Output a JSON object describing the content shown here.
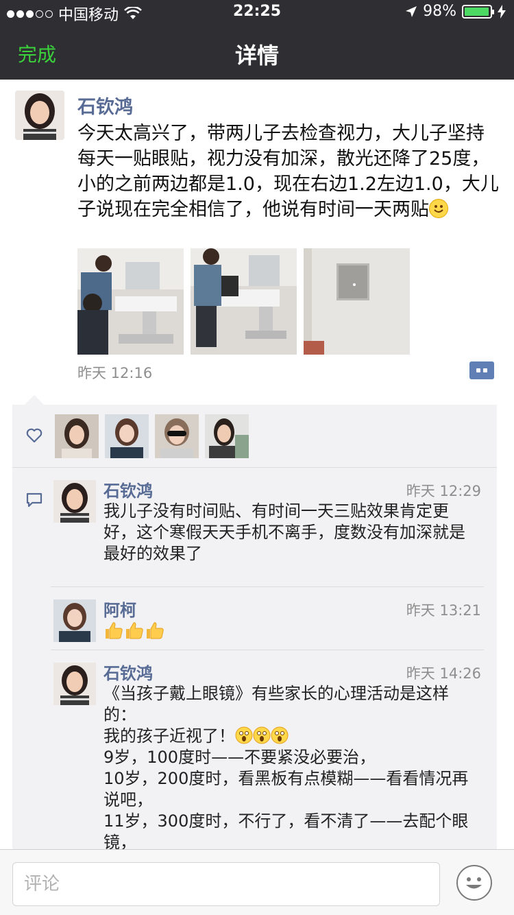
{
  "status_bar": {
    "carrier": "中国移动",
    "time": "22:25",
    "battery": "98%",
    "battery_level": 0.98
  },
  "nav": {
    "done_label": "完成",
    "title": "详情"
  },
  "post": {
    "author": "石钦鸿",
    "text": "今天太高兴了，带两儿子去检查视力，大儿子坚持每天一贴眼贴，视力没有加深，散光还降了25度，小的之前两边都是1.0，现在右边1.2左边1.0，大儿子说现在完全相信了，他说有时间一天两贴",
    "time": "昨天 12:16",
    "photo_count": 3
  },
  "likes": {
    "count": 4
  },
  "comments": [
    {
      "name": "石钦鸿",
      "time": "昨天 12:29",
      "text": "我儿子没有时间贴、有时间一天三贴效果肯定更好，这个寒假天天手机不离手，度数没有加深就是最好的效果了"
    },
    {
      "name": "阿柯",
      "time": "昨天 13:21",
      "text": ""
    },
    {
      "name": "石钦鸿",
      "time": "昨天 14:26",
      "text_intro": "《当孩子戴上眼镜》有些家长的心理活动是这样的：",
      "text_line2": "我的孩子近视了！",
      "text_rest": "9岁，100度时——不要紧没必要治，\n10岁，200度时，看黑板有点模糊——看看情况再说吧，\n11岁，300度时，不行了，看不清了——去配个眼镜，"
    }
  ],
  "comment_input": {
    "placeholder": "评论"
  },
  "colors": {
    "nav_bg": "#2e2e33",
    "done_green": "#3ad13a",
    "name_blue": "#576b95",
    "panel_bg": "#f2f2f4"
  }
}
